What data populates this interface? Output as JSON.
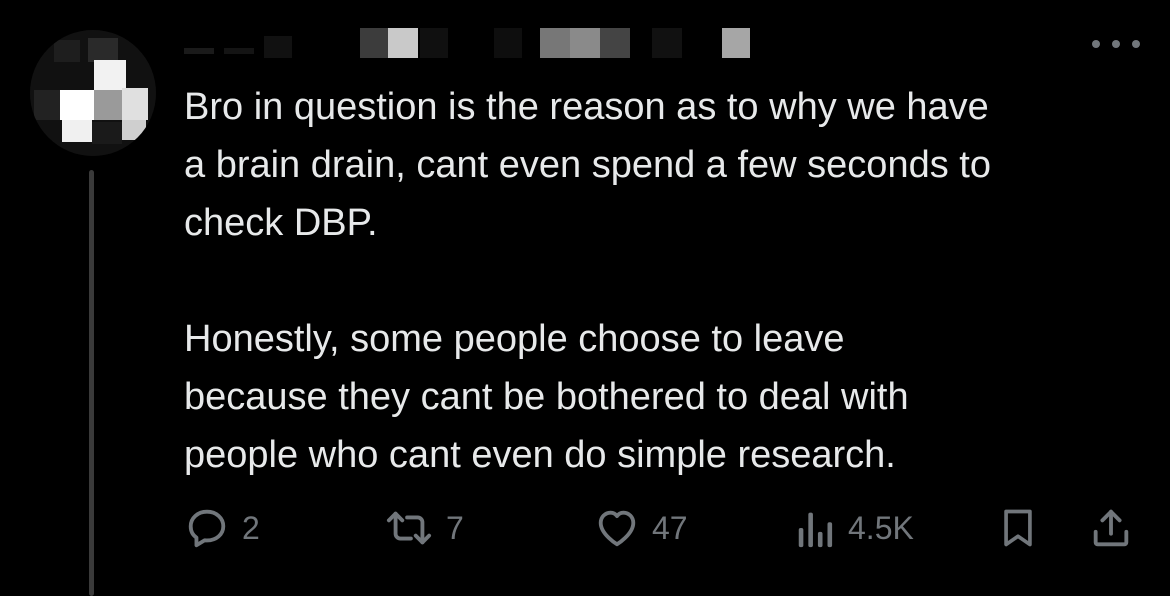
{
  "tweet": {
    "lines": [
      "Bro in question is the reason as to why we have",
      "a brain drain, cant even spend a few seconds to",
      "check DBP.",
      "",
      "Honestly, some people choose to leave",
      "because they cant be bothered to deal with",
      "people who cant even do simple research."
    ]
  },
  "actions": {
    "reply_count": "2",
    "retweet_count": "7",
    "like_count": "47",
    "views_count": "4.5K"
  },
  "icons": {
    "reply": "reply-icon",
    "retweet": "retweet-icon",
    "like": "heart-icon",
    "views": "views-icon",
    "bookmark": "bookmark-icon",
    "share": "share-icon",
    "more": "more-icon"
  },
  "colors": {
    "background": "#000000",
    "text": "#e7e9ea",
    "muted": "#71767b"
  }
}
